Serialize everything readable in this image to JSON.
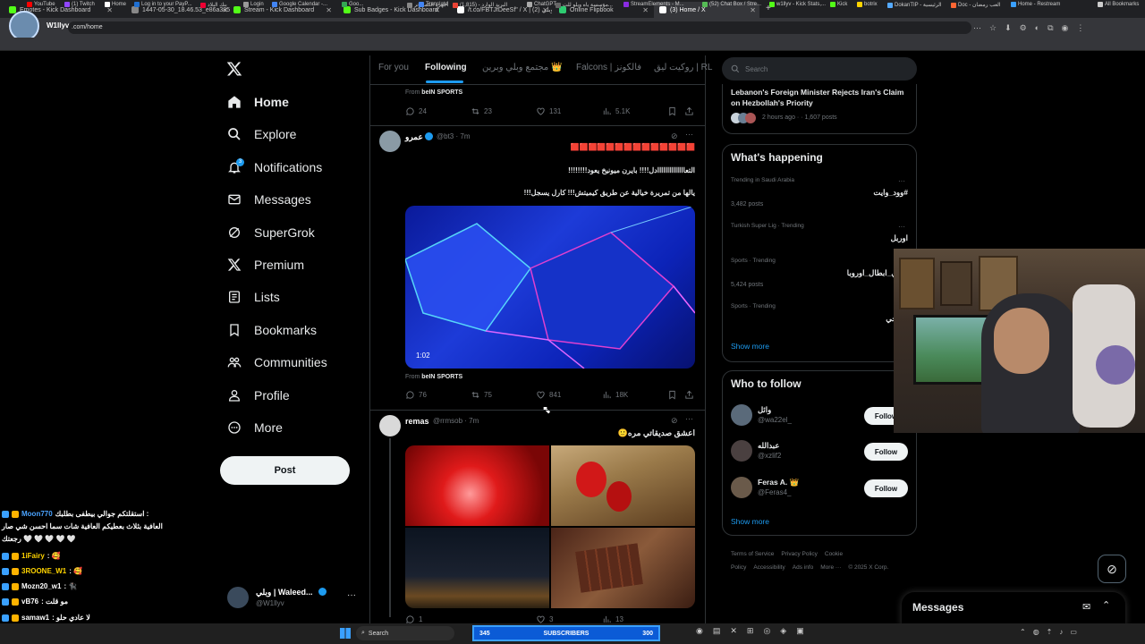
{
  "browser": {
    "tabs": [
      {
        "title": "Emotes - Kick Dashboard",
        "color": "#53fc18"
      },
      {
        "title": "1447-05-30_18.46.53_e86a385",
        "color": "#888888"
      },
      {
        "title": "Stream - Kick Dashboard",
        "color": "#53fc18"
      },
      {
        "title": "Sub Badges - Kick Dashboard",
        "color": "#53fc18"
      },
      {
        "title": "/t.co/FBTJfDeeSf\" / X | وبلي (2)",
        "color": "#ffffff"
      },
      {
        "title": "Online Flipbook",
        "color": "#2ecc71"
      },
      {
        "title": "(3) Home / X",
        "color": "#ffffff"
      }
    ],
    "profile_name": "W1llyv",
    "url": ".com/home",
    "bookmarks": [
      "YouTube",
      "(1) Twitch",
      "Home",
      "Log in to your PayP...",
      "بنك البلاد",
      "Login",
      "Google Calendar -...",
      "Goo...",
      "أجهزة الكمبيوتر",
      "Translate",
      "البريد الوارد - (1,815)",
      "ChatGPT",
      "مؤسسة ياه ويلو للت...",
      "StreamElements - M...",
      "(52) Chat Box / Stre...",
      "w1llyv - Kick Stats,...",
      "Kick",
      "botrix",
      "DokanTIP - الرئيسية",
      "Doc - العب رمضان",
      "Home - Restream",
      "All Bookmarks"
    ]
  },
  "nav": {
    "items": [
      {
        "label": "Home",
        "icon": "home-icon"
      },
      {
        "label": "Explore",
        "icon": "search-icon"
      },
      {
        "label": "Notifications",
        "icon": "bell-icon"
      },
      {
        "label": "Messages",
        "icon": "mail-icon"
      },
      {
        "label": "SuperGrok",
        "icon": "grok-icon"
      },
      {
        "label": "Premium",
        "icon": "x-logo-icon"
      },
      {
        "label": "Lists",
        "icon": "list-icon"
      },
      {
        "label": "Bookmarks",
        "icon": "bookmark-icon"
      },
      {
        "label": "Communities",
        "icon": "communities-icon"
      },
      {
        "label": "Profile",
        "icon": "profile-icon"
      },
      {
        "label": "More",
        "icon": "more-icon"
      }
    ],
    "notification_count": "3",
    "post_label": "Post",
    "account_name": "وبلي | Waleed...",
    "account_handle": "@W1llyv"
  },
  "feed": {
    "tabs": [
      "For you",
      "Following",
      "مجتمع وبلي وبرين 👑",
      "Falcons | فالكونز",
      "روكيت ليق | RL"
    ],
    "tweet0": {
      "from_label": "From",
      "from_name": "beIN SPORTS",
      "replies": "24",
      "reposts": "23",
      "likes": "131",
      "views": "5.1K"
    },
    "tweet1": {
      "name": "عمرو",
      "handle": "@bt3",
      "time": "· 7m",
      "line1": "🟥🟥🟥🟥🟥🟥🟥🟥🟥🟥🟥🟥🟥🟥",
      "line2": "التعاااااااااااااادل!!!! بايرن ميونيخ يعود!!!!!!!!",
      "line3": "يالها من تمريرة خيالية عن طريق كيميتش!!! كارل يسجل!!!",
      "duration": "1:02",
      "from_label": "From",
      "from_name": "beIN SPORTS",
      "replies": "76",
      "reposts": "75",
      "likes": "841",
      "views": "18K"
    },
    "tweet2": {
      "name": "remas",
      "handle": "@rrmsob",
      "time": "· 7m",
      "text": "اعشق صديقاتي مره🙂",
      "replies": "1",
      "reposts": "",
      "likes": "3",
      "views": "13"
    }
  },
  "right": {
    "search_placeholder": "Search",
    "news_title": "Lebanon's Foreign Minister Rejects Iran's Claim on Hezbollah's Priority",
    "news_meta": "2 hours ago · · 1,607 posts",
    "happening_title": "What's happening",
    "trends": [
      {
        "context": "Trending in Saudi Arabia",
        "name": "#وود_وايت",
        "posts": "3,482 posts"
      },
      {
        "context": "Turkish Super Lig · Trending",
        "name": "اوربل",
        "posts": ""
      },
      {
        "context": "Sports · Trending",
        "name": "دوري_ابطال_اوروبا",
        "posts": "5,424 posts"
      },
      {
        "context": "Sports · Trending",
        "name": "قهوجي",
        "posts": ""
      }
    ],
    "show_more": "Show more",
    "who_title": "Who to follow",
    "follow": [
      {
        "name": "وائل",
        "handle": "@wa22el_"
      },
      {
        "name": "عبدالله",
        "handle": "@xzlif2"
      },
      {
        "name": "Feras A. 👑",
        "handle": "@Feras4_"
      }
    ],
    "follow_label": "Follow",
    "footer": [
      "Terms of Service",
      "Privacy Policy",
      "Cookie Policy",
      "Accessibility",
      "Ads info",
      "More ···",
      "© 2025 X Corp."
    ],
    "messages_label": "Messages"
  },
  "chat": [
    {
      "user": "Moon770",
      "text": "استقلتكم جوالي بيطفى بطلبك :",
      "color": "#4aa3ff"
    },
    {
      "user": "",
      "text": "العافية بثلاث بعطيكم العافية شات سما احسن شي صار",
      "color": "#ffffff"
    },
    {
      "user": "",
      "text": "رجعتك 🤍 🤍 🤍 🤍 🤍",
      "color": "#ffffff"
    },
    {
      "user": "1iFairy",
      "text": ": 🥰",
      "color": "#ffd400"
    },
    {
      "user": "3ROONE_W1",
      "text": ": 🥰",
      "color": "#ffd400"
    },
    {
      "user": "Mozn20_w1",
      "text": ": 🐈‍⬛",
      "color": "#ffffff"
    },
    {
      "user": "vB76",
      "text": ": مو قلت",
      "color": "#ffffff"
    },
    {
      "user": "samaw1",
      "text": ": لا عادي حلو",
      "color": "#ffffff"
    },
    {
      "user": "3ROONE_W1",
      "text": ": 🥰",
      "color": "#ffd400"
    }
  ],
  "overlay": {
    "subs_label": "SUBSCRIBERS",
    "subs_count": "345",
    "subs_goal": "300"
  },
  "taskbar": {
    "search": "Search"
  }
}
